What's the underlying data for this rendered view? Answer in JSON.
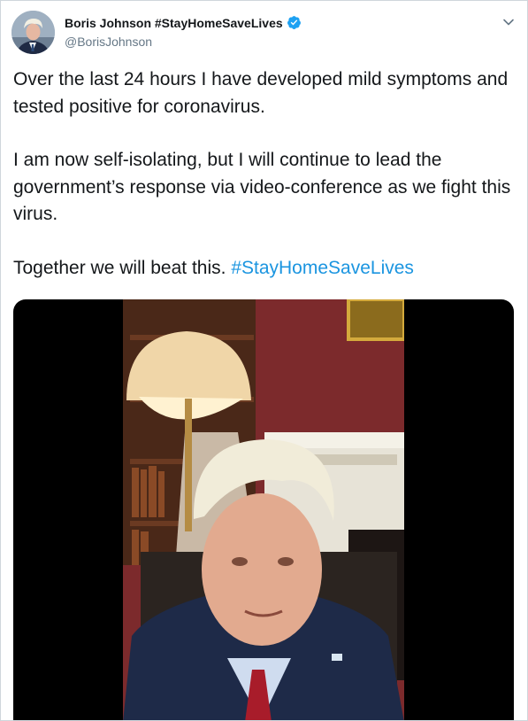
{
  "tweet": {
    "author": {
      "display_name": "Boris Johnson #StayHomeSaveLives",
      "handle": "@BorisJohnson",
      "verified": true,
      "avatar_icon": "user-avatar-photo"
    },
    "paragraphs": [
      {
        "text": "Over the last 24 hours I have developed mild symptoms and tested positive for coronavirus."
      },
      {
        "text": "I am now self-isolating, but I will continue to lead the government’s response via video-conference as we fight this virus."
      },
      {
        "text": "Together we will beat this.",
        "hashtag": "#StayHomeSaveLives"
      }
    ],
    "media": {
      "type": "video",
      "icon": "video-frame"
    },
    "menu_icon": "chevron-down-icon"
  },
  "colors": {
    "link": "#1b95e0",
    "verified_badge": "#1da1f2",
    "secondary_text": "#657786",
    "primary_text": "#14171a",
    "border": "#cfd6dc"
  }
}
